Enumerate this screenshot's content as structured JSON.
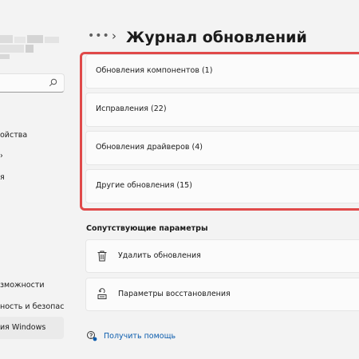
{
  "header": {
    "more_label": "•••",
    "chevron": "›",
    "title": "Журнал обновлений"
  },
  "sidebar": {
    "items": [
      {
        "label": "ойства"
      },
      {
        "label": "я"
      },
      {
        "label": "зможности"
      },
      {
        "label": "ность и безопас"
      },
      {
        "label": "ия Windows"
      }
    ]
  },
  "history": {
    "items": [
      {
        "label": "Обновления компонентов (1)"
      },
      {
        "label": "Исправления (22)"
      },
      {
        "label": "Обновления драйверов (4)"
      },
      {
        "label": "Другие обновления (15)"
      }
    ]
  },
  "related": {
    "title": "Сопутствующие параметры",
    "items": [
      {
        "label": "Удалить обновления",
        "icon": "trash-icon"
      },
      {
        "label": "Параметры восстановления",
        "icon": "recovery-icon"
      }
    ]
  },
  "help": {
    "label": "Получить помощь",
    "icon": "help-chat-icon"
  },
  "colors": {
    "highlight": "#e04a4a",
    "link": "#0b5cad",
    "background": "#f3f3f3",
    "card": "#fbfbfb"
  }
}
